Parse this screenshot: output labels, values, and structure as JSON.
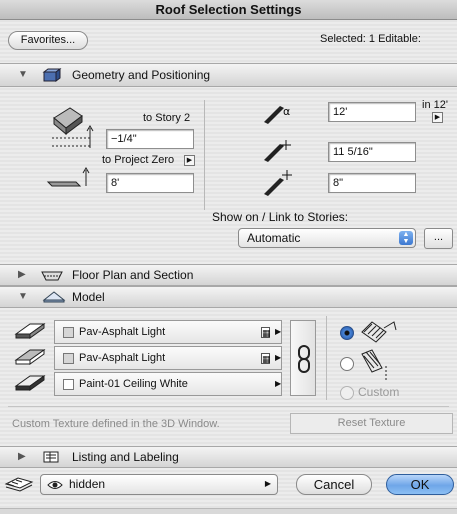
{
  "window": {
    "title": "Roof Selection Settings"
  },
  "header": {
    "favorites_label": "Favorites...",
    "selected_info": "Selected: 1 Editable:"
  },
  "sections": {
    "geometry": "Geometry and Positioning",
    "floor_plan": "Floor Plan and Section",
    "model": "Model",
    "listing": "Listing and Labeling"
  },
  "geometry": {
    "to_story_label": "to Story 2",
    "story_offset_value": "−1/4\"",
    "to_project_zero_label": "to Project Zero",
    "thickness_value": "8'",
    "pitch_value": "12'",
    "pitch_unit_label": "in 12'",
    "height_value": "11 5/16\"",
    "edge_value": "8\"",
    "show_on_label": "Show on / Link to Stories:",
    "show_on_value": "Automatic",
    "more_button_label": "..."
  },
  "model": {
    "materials": [
      {
        "name": "Pav-Asphalt Light"
      },
      {
        "name": "Pav-Asphalt Light"
      },
      {
        "name": "Paint-01 Ceiling White"
      }
    ],
    "custom_label": "Custom",
    "texture_note": "Custom Texture defined in the 3D Window.",
    "reset_texture_label": "Reset Texture"
  },
  "footer": {
    "layer_value": "hidden",
    "cancel_label": "Cancel",
    "ok_label": "OK"
  },
  "colors": {
    "ok_blue": "#6fa6e8",
    "radio_blue": "#4a86d8",
    "background": "#e8e8e8"
  }
}
